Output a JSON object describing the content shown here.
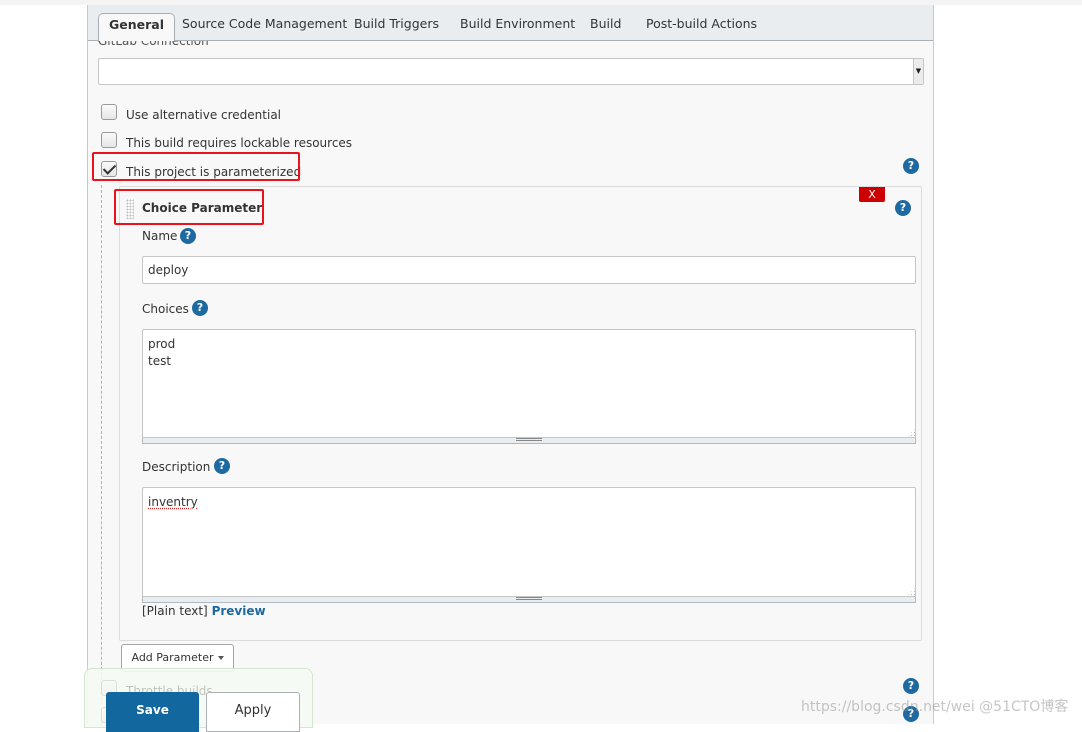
{
  "tabs": [
    {
      "label": "General",
      "active": true
    },
    {
      "label": "Source Code Management",
      "active": false
    },
    {
      "label": "Build Triggers",
      "active": false
    },
    {
      "label": "Build Environment",
      "active": false
    },
    {
      "label": "Build",
      "active": false
    },
    {
      "label": "Post-build Actions",
      "active": false
    }
  ],
  "gitlab": {
    "label": "GitLab Connection",
    "value": ""
  },
  "options": [
    {
      "label": "Use alternative credential",
      "checked": false
    },
    {
      "label": "This build requires lockable resources",
      "checked": false
    },
    {
      "label": "This project is parameterized",
      "checked": true
    }
  ],
  "parameter": {
    "title": "Choice Parameter",
    "delete_label": "X",
    "name_label": "Name",
    "name_value": "deploy",
    "choices_label": "Choices",
    "choices_value": "prod\ntest",
    "description_label": "Description",
    "description_value": "inventry",
    "plain_text_label": "[Plain text]",
    "preview_label": "Preview"
  },
  "add_parameter_label": "Add Parameter",
  "hidden_options": [
    {
      "label": "Throttle builds",
      "checked": false
    }
  ],
  "buttons": {
    "save": "Save",
    "apply": "Apply"
  },
  "help_glyph": "?",
  "watermark": "https://blog.csdn.net/wei @51CTO博客",
  "colors": {
    "accent": "#12679e",
    "help": "#1e6aa0",
    "delete": "#cc0000",
    "highlight": "#e8141b"
  }
}
